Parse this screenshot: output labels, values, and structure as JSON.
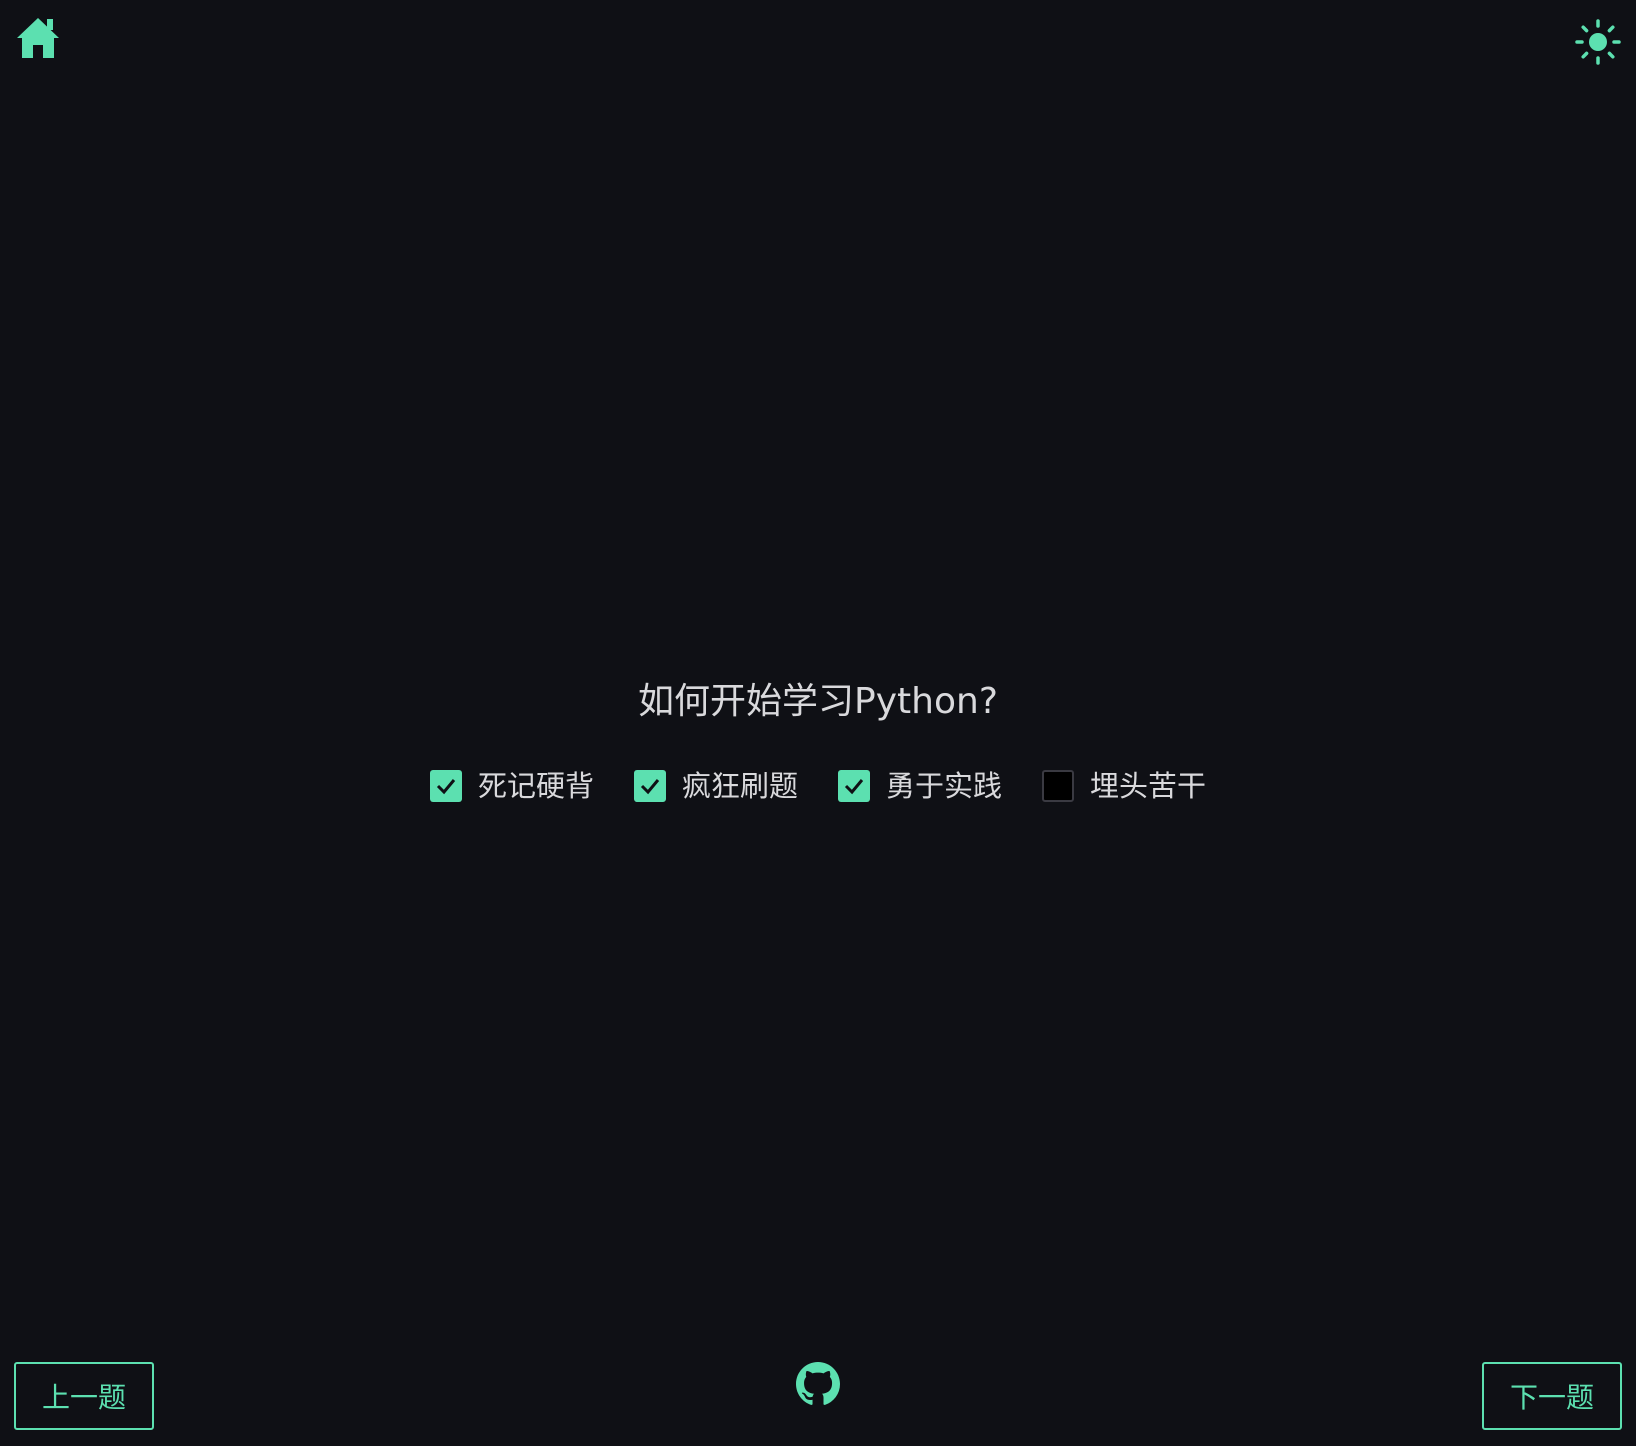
{
  "header": {
    "home_icon": "home-icon",
    "theme_icon": "sun-icon"
  },
  "question": {
    "text": "如何开始学习Python?"
  },
  "options": [
    {
      "label": "死记硬背",
      "checked": true
    },
    {
      "label": "疯狂刷题",
      "checked": true
    },
    {
      "label": "勇于实践",
      "checked": true
    },
    {
      "label": "埋头苦干",
      "checked": false
    }
  ],
  "footer": {
    "prev_label": "上一题",
    "next_label": "下一题",
    "github_icon": "github-icon"
  },
  "colors": {
    "background": "#0f1015",
    "accent": "#5ce0b0",
    "text": "#d9d9dc"
  }
}
